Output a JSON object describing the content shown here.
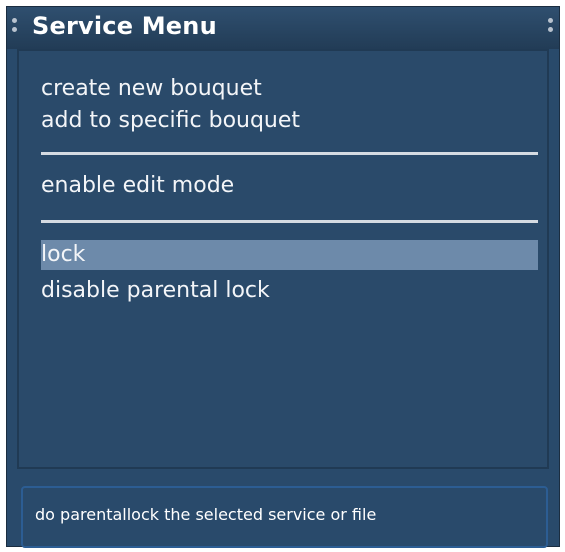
{
  "window": {
    "title": "Service Menu"
  },
  "menu": {
    "items": [
      {
        "label": "create new bouquet"
      },
      {
        "label": "add to specific bouquet"
      },
      {
        "label": "enable edit mode"
      },
      {
        "label": "lock",
        "selected": true
      },
      {
        "label": "disable parental lock"
      }
    ]
  },
  "status": {
    "text": "do parentallock the selected service or file"
  },
  "colors": {
    "background": "#294a6b",
    "selection": "#6d8aaa",
    "separator": "#d5dbe2",
    "text": "#f3f5f8",
    "status_border": "#2c5d93"
  }
}
